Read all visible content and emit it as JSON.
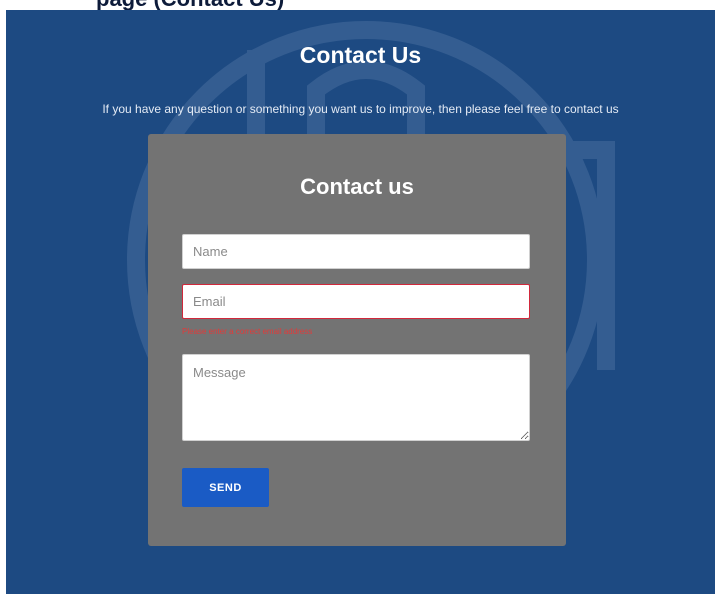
{
  "header": {
    "partial_title": "page (Contact Us)"
  },
  "hero": {
    "title": "Contact Us",
    "subtitle": "If you have any question or something you want us to improve, then please feel free to contact us"
  },
  "form": {
    "title": "Contact us",
    "name_placeholder": "Name",
    "email_placeholder": "Email",
    "email_error": "Please enter a correct email address",
    "message_placeholder": "Message",
    "send_label": "SEND"
  },
  "colors": {
    "background": "#1d4a82",
    "card": "#737373",
    "button": "#1a5bc5",
    "error": "#d1283b"
  }
}
